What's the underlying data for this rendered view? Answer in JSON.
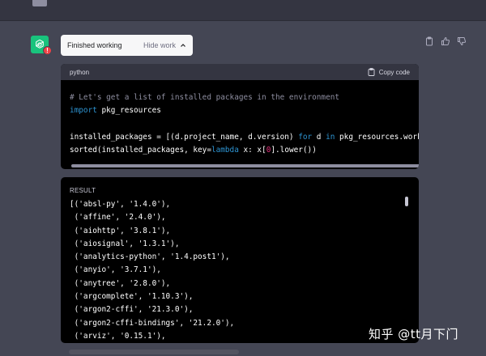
{
  "work_pill": {
    "status": "Finished working",
    "hide_label": "Hide work"
  },
  "code_block": {
    "language": "python",
    "copy_label": "Copy code"
  },
  "result": {
    "label": "RESULT",
    "lines": [
      "[('absl-py', '1.4.0'),",
      " ('affine', '2.4.0'),",
      " ('aiohttp', '3.8.1'),",
      " ('aiosignal', '1.3.1'),",
      " ('analytics-python', '1.4.post1'),",
      " ('anyio', '3.7.1'),",
      " ('anytree', '2.8.0'),",
      " ('argcomplete', '1.10.3'),",
      " ('argon2-cffi', '21.3.0'),",
      " ('argon2-cffi-bindings', '21.2.0'),",
      " ('arviz', '0.15.1'),"
    ]
  },
  "colors": {
    "background": "#444654",
    "avatar": "#19c37d",
    "code_bg": "#000000",
    "keyword": "#2e95d3",
    "number": "#df3079",
    "comment": "#8e8ea0"
  },
  "icons": [
    "chatgpt-logo-icon",
    "error-badge-icon",
    "clipboard-icon",
    "thumbs-up-icon",
    "thumbs-down-icon",
    "chevron-up-icon",
    "copy-icon"
  ],
  "watermark": "知乎 @tt月下门"
}
